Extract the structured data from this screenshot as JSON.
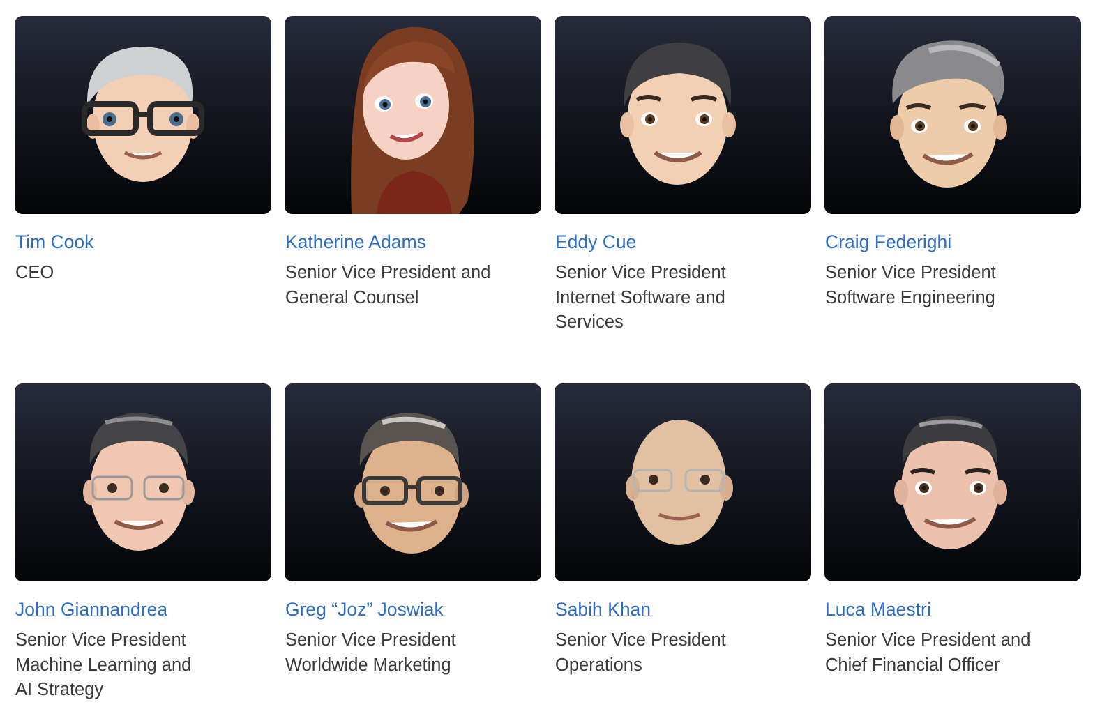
{
  "executives": [
    {
      "name": "Tim Cook",
      "title_lines": [
        "CEO"
      ],
      "avatar_icon": "tim-cook-memoji-icon",
      "colors": {
        "skin": "#f3cfb6",
        "hair": "#cfd0d2",
        "glasses": "#2a2a2a"
      }
    },
    {
      "name": "Katherine Adams",
      "title_lines": [
        "Senior Vice President and",
        "General Counsel"
      ],
      "avatar_icon": "katherine-adams-memoji-icon",
      "colors": {
        "skin": "#f6d2c4",
        "hair": "#7b3d22",
        "shirt": "#7a2618"
      }
    },
    {
      "name": "Eddy Cue",
      "title_lines": [
        "Senior Vice President",
        "Internet Software and",
        "Services"
      ],
      "avatar_icon": "eddy-cue-memoji-icon",
      "colors": {
        "skin": "#f2d0b4",
        "hair": "#3f3f42"
      }
    },
    {
      "name": "Craig Federighi",
      "title_lines": [
        "Senior Vice President",
        "Software Engineering"
      ],
      "avatar_icon": "craig-federighi-memoji-icon",
      "colors": {
        "skin": "#eecbab",
        "hair": "#8a8a8c"
      }
    },
    {
      "name": "John Giannandrea",
      "title_lines": [
        "Senior Vice President",
        "Machine Learning and",
        "AI Strategy"
      ],
      "avatar_icon": "john-giannandrea-memoji-icon",
      "colors": {
        "skin": "#f0c8b2",
        "hair": "#444446",
        "glasses": "#9a9a9a"
      }
    },
    {
      "name": "Greg “Joz” Joswiak",
      "title_lines": [
        "Senior Vice President",
        "Worldwide Marketing"
      ],
      "avatar_icon": "greg-joswiak-memoji-icon",
      "colors": {
        "skin": "#ddb18c",
        "hair": "#5a5450",
        "glasses": "#3a3a3a"
      }
    },
    {
      "name": "Sabih Khan",
      "title_lines": [
        "Senior Vice President",
        "Operations"
      ],
      "avatar_icon": "sabih-khan-memoji-icon",
      "colors": {
        "skin": "#e2c0a2",
        "hair": "#e2c0a2",
        "glasses": "#b5b5b5"
      }
    },
    {
      "name": "Luca Maestri",
      "title_lines": [
        "Senior Vice President and",
        "Chief Financial Officer"
      ],
      "avatar_icon": "luca-maestri-memoji-icon",
      "colors": {
        "skin": "#ecc2ae",
        "hair": "#3c3c3e"
      }
    }
  ]
}
